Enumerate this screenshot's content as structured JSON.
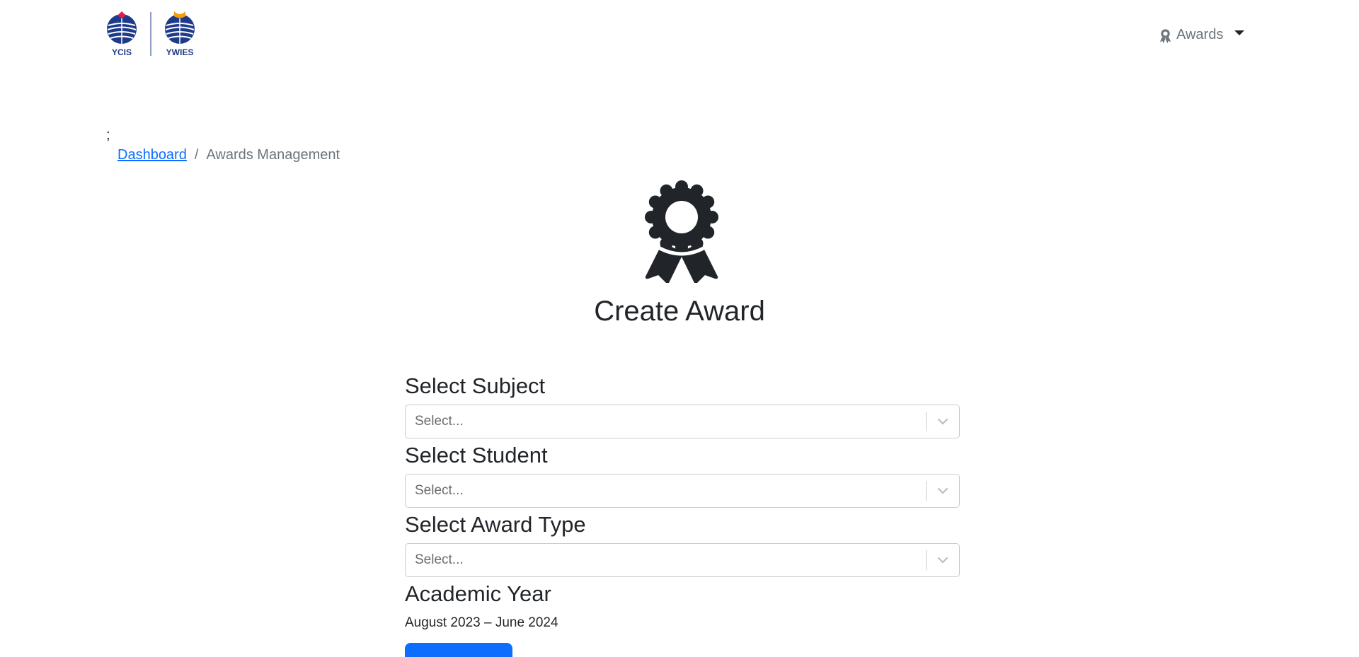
{
  "header": {
    "logo_left_text": "YCIS",
    "logo_right_text": "YWIES",
    "menu_label": "Awards",
    "menu_icon": "award-icon"
  },
  "stray_text": ";",
  "breadcrumb": {
    "home": "Dashboard",
    "separator": "/",
    "current": "Awards Management"
  },
  "main": {
    "hero_icon": "award-ribbon-icon",
    "title": "Create Award"
  },
  "form": {
    "subject": {
      "label": "Select Subject",
      "placeholder": "Select..."
    },
    "student": {
      "label": "Select Student",
      "placeholder": "Select..."
    },
    "award_type": {
      "label": "Select Award Type",
      "placeholder": "Select..."
    },
    "academic_year": {
      "label": "Academic Year",
      "value": "August 2023 – June 2024"
    }
  },
  "colors": {
    "primary": "#0d6efd",
    "logo_blue": "#1e3a8a",
    "logo_red": "#e11d48",
    "logo_orange": "#f59e0b",
    "text": "#212529",
    "muted": "#6c757d"
  }
}
